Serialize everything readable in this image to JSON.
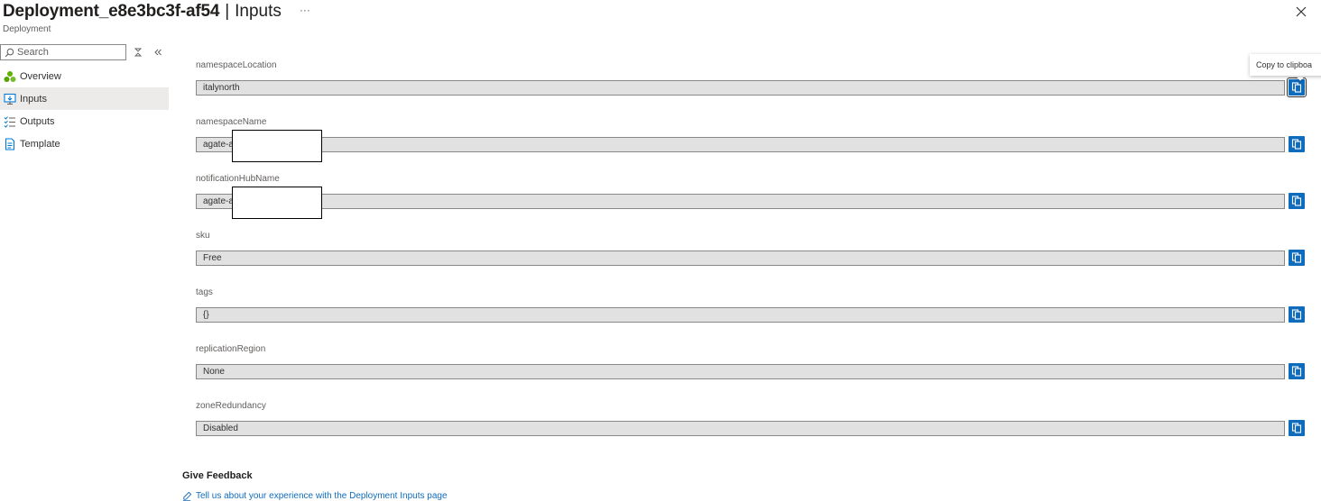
{
  "header": {
    "title": "Deployment_e8e3bc3f-af54",
    "separator": "|",
    "page": "Inputs",
    "more": "···",
    "subtitle": "Deployment"
  },
  "search": {
    "placeholder": "Search"
  },
  "sidebar": {
    "items": [
      {
        "label": "Overview",
        "icon": "overview-icon",
        "active": false
      },
      {
        "label": "Inputs",
        "icon": "inputs-icon",
        "active": true
      },
      {
        "label": "Outputs",
        "icon": "outputs-icon",
        "active": false
      },
      {
        "label": "Template",
        "icon": "template-icon",
        "active": false
      }
    ]
  },
  "fields": [
    {
      "label": "namespaceLocation",
      "value": "italynorth"
    },
    {
      "label": "namespaceName",
      "value": "agate-a"
    },
    {
      "label": "notificationHubName",
      "value": "agate-a"
    },
    {
      "label": "sku",
      "value": "Free"
    },
    {
      "label": "tags",
      "value": "{}"
    },
    {
      "label": "replicationRegion",
      "value": "None"
    },
    {
      "label": "zoneRedundancy",
      "value": "Disabled"
    }
  ],
  "tooltip": {
    "text": "Copy to clipboa"
  },
  "feedback": {
    "title": "Give Feedback",
    "link": "Tell us about your experience with the Deployment Inputs page"
  },
  "colors": {
    "accent": "#0f6cbd",
    "field_bg": "#e1e1e1",
    "active_nav": "#edebe9"
  }
}
